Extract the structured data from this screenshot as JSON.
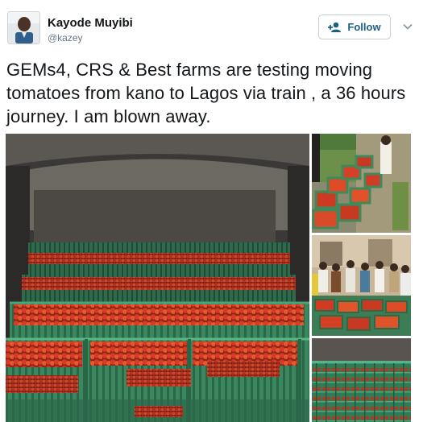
{
  "author": {
    "name": "Kayode Muyibi",
    "handle": "@kazey",
    "avatar_icon": "profile-photo"
  },
  "actions": {
    "follow_label": "Follow",
    "follow_icon": "add-user-icon",
    "menu_icon": "chevron-down-icon"
  },
  "tweet": {
    "text": "GEMs4, CRS & Best farms are testing moving tomatoes from kano to Lagos via train ,  a 36 hours journey. I am blown away."
  },
  "media": {
    "photos": [
      "tomato-crates-in-wagon",
      "tomato-farm-field",
      "crowd-with-crates",
      "stacked-green-crates"
    ]
  },
  "colors": {
    "accent": "#1b5e86",
    "text": "#14171a",
    "muted": "#657786",
    "crate_green": "#3f8a62",
    "tomato_red": "#d9362a"
  }
}
